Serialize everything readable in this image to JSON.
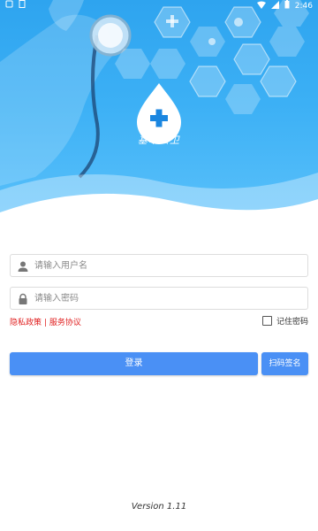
{
  "status_bar": {
    "time": "2:46"
  },
  "header": {
    "logo_text": "基本公卫"
  },
  "form": {
    "username_placeholder": "请输入用户名",
    "password_placeholder": "请输入密码",
    "privacy_label": "隐私政策",
    "separator": "|",
    "service_label": "服务协议",
    "remember_label": "记住密码",
    "login_label": "登录",
    "scan_label": "扫码签名"
  },
  "footer": {
    "version": "Version 1.11"
  },
  "colors": {
    "primary": "#4a90f5",
    "header_blue": "#2ea4ef",
    "link_red": "#e02020"
  }
}
